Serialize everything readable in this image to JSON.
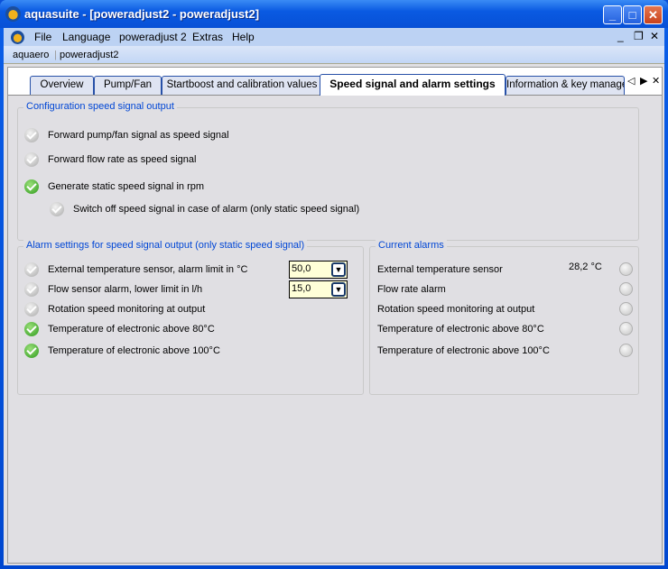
{
  "window": {
    "title": "aquasuite - [poweradjust2 - poweradjust2]"
  },
  "menu": [
    "File",
    "Language",
    "poweradjust 2",
    "Extras",
    "Help"
  ],
  "breadcrumb": [
    "aquaero",
    "poweradjust2"
  ],
  "tabs": [
    "Overview",
    "Pump/Fan",
    "Startboost and calibration values",
    "Speed signal and alarm settings",
    "Information & key manage"
  ],
  "active_tab": "Speed signal and alarm settings",
  "config": {
    "title": "Configuration speed signal output",
    "items": [
      {
        "label": "Forward pump/fan signal as speed signal",
        "checked": false
      },
      {
        "label": "Forward flow rate as speed signal",
        "checked": false
      },
      {
        "label": "Generate static speed signal in rpm",
        "checked": true
      },
      {
        "label": "Switch off speed signal in case of alarm (only static speed signal)",
        "checked": false
      }
    ]
  },
  "alarms": {
    "title": "Alarm settings for speed signal output (only static speed signal)",
    "items": [
      {
        "label": "External temperature sensor, alarm limit in °C",
        "checked": false,
        "value": "50,0"
      },
      {
        "label": "Flow sensor alarm, lower limit in l/h",
        "checked": false,
        "value": "15,0"
      },
      {
        "label": "Rotation speed monitoring at output",
        "checked": false
      },
      {
        "label": "Temperature of electronic above 80°C",
        "checked": true
      },
      {
        "label": "Temperature of electronic above 100°C",
        "checked": true
      }
    ]
  },
  "current": {
    "title": "Current alarms",
    "items": [
      {
        "label": "External temperature sensor",
        "value": "28,2 °C"
      },
      {
        "label": "Flow rate alarm"
      },
      {
        "label": "Rotation speed monitoring at output"
      },
      {
        "label": "Temperature of electronic above 80°C"
      },
      {
        "label": "Temperature of electronic above 100°C"
      }
    ]
  }
}
